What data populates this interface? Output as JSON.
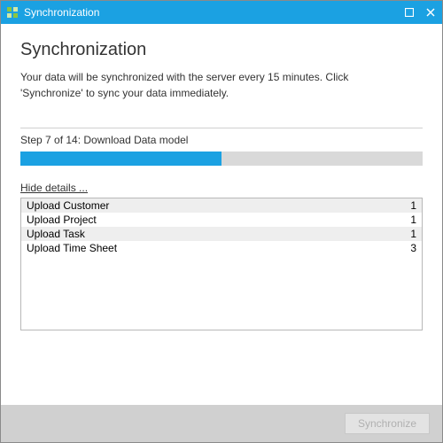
{
  "window": {
    "title": "Synchronization"
  },
  "header": {
    "title": "Synchronization",
    "description": "Your data will be synchronized with the server every 15 minutes. Click 'Synchronize' to sync your data immediately."
  },
  "progress": {
    "step_label": "Step 7 of 14: Download Data model",
    "current_step": 7,
    "total_steps": 14,
    "percent": 50
  },
  "details": {
    "toggle_label": "Hide details ...",
    "rows": [
      {
        "name": "Upload Customer",
        "count": "1"
      },
      {
        "name": "Upload Project",
        "count": "1"
      },
      {
        "name": "Upload Task",
        "count": "1"
      },
      {
        "name": "Upload Time Sheet",
        "count": "3"
      }
    ]
  },
  "footer": {
    "sync_button": "Synchronize"
  }
}
